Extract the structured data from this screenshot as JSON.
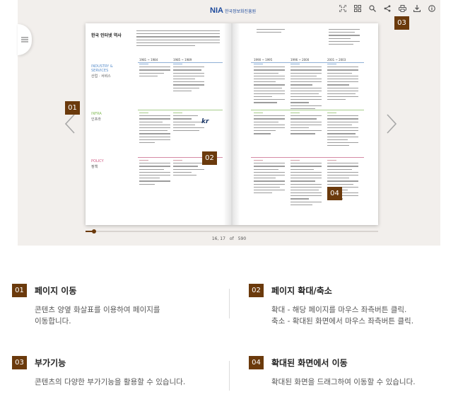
{
  "header": {
    "brand": "NIA",
    "brand_sub": "한국정보화진흥원"
  },
  "toolbar": {
    "icons": [
      "fullscreen-icon",
      "grid-icon",
      "search-icon",
      "share-icon",
      "print-icon",
      "download-icon",
      "info-icon"
    ]
  },
  "book": {
    "left_page_title": "한국 인터넷 역사",
    "sections": [
      {
        "name": "INDUSTRY &\nSERVICES",
        "sub": "산업 · 서비스",
        "color": "#5b8fcb"
      },
      {
        "name": "INFRA",
        "sub": "인프라",
        "color": "#86be5a"
      },
      {
        "name": "POLICY",
        "sub": "정책",
        "color": "#d05a84"
      }
    ],
    "left_years": [
      "1981 ~ 1984",
      "1985 ~ 1989"
    ],
    "right_years": [
      "1990 ~ 1995",
      "1996 ~ 2000",
      "2001 ~ 2003"
    ],
    "kr_logo": "kr"
  },
  "badges": {
    "b1": "01",
    "b2": "02",
    "b3": "03",
    "b4": "04"
  },
  "pager": {
    "current": "16, 17",
    "of": "of",
    "total": "590",
    "progress": 0.03
  },
  "legend": [
    {
      "num": "01",
      "title": "페이지 이동",
      "desc": [
        "콘텐츠 양옆 화살표를 이용하여 페이지를",
        "이동합니다."
      ]
    },
    {
      "num": "02",
      "title": "페이지 확대/축소",
      "desc": [
        "확대 - 해당 페이지를 마우스 좌측버튼 클릭.",
        "축소 - 확대된 화면에서 마우스 좌측버튼 클릭."
      ]
    },
    {
      "num": "03",
      "title": "부가기능",
      "desc": [
        "콘텐츠의 다양한 부가기능을 활용할 수 있습니다."
      ]
    },
    {
      "num": "04",
      "title": "확대된 화면에서 이동",
      "desc": [
        "확대된 화면을 드래그하여 이동할 수 있습니다."
      ]
    }
  ]
}
